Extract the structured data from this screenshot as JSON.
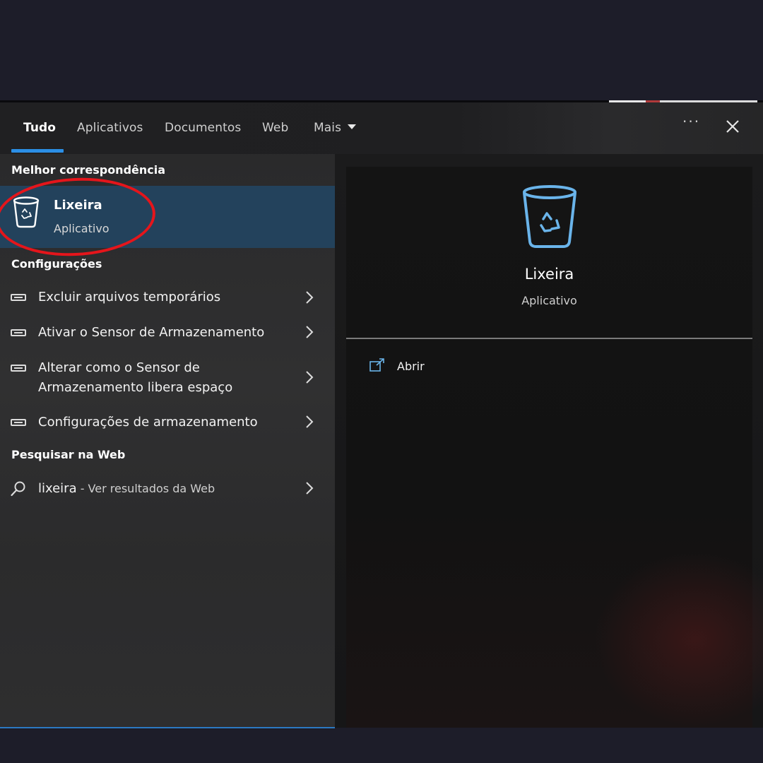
{
  "tabs": [
    {
      "label": "Tudo"
    },
    {
      "label": "Aplicativos"
    },
    {
      "label": "Documentos"
    },
    {
      "label": "Web"
    },
    {
      "label": "Mais"
    }
  ],
  "toolbar": {
    "more_label": "···"
  },
  "sections": {
    "best_match": "Melhor correspondência",
    "settings": "Configurações",
    "web": "Pesquisar na Web"
  },
  "best_match": {
    "title": "Lixeira",
    "subtitle": "Aplicativo"
  },
  "settings_items": [
    {
      "label": "Excluir arquivos temporários"
    },
    {
      "label": "Ativar o Sensor de Armazenamento"
    },
    {
      "label_line1": "Alterar como o Sensor de",
      "label_line2": "Armazenamento libera espaço"
    },
    {
      "label": "Configurações de armazenamento"
    }
  ],
  "web_search": {
    "term": "lixeira",
    "suffix": " - Ver resultados da Web"
  },
  "detail": {
    "title": "Lixeira",
    "subtitle": "Aplicativo",
    "open_label": "Abrir"
  },
  "colors": {
    "accent": "#2b8fe6",
    "highlight": "#23425c",
    "icon_blue": "#6ab4ea",
    "annotation": "#e5151b"
  }
}
